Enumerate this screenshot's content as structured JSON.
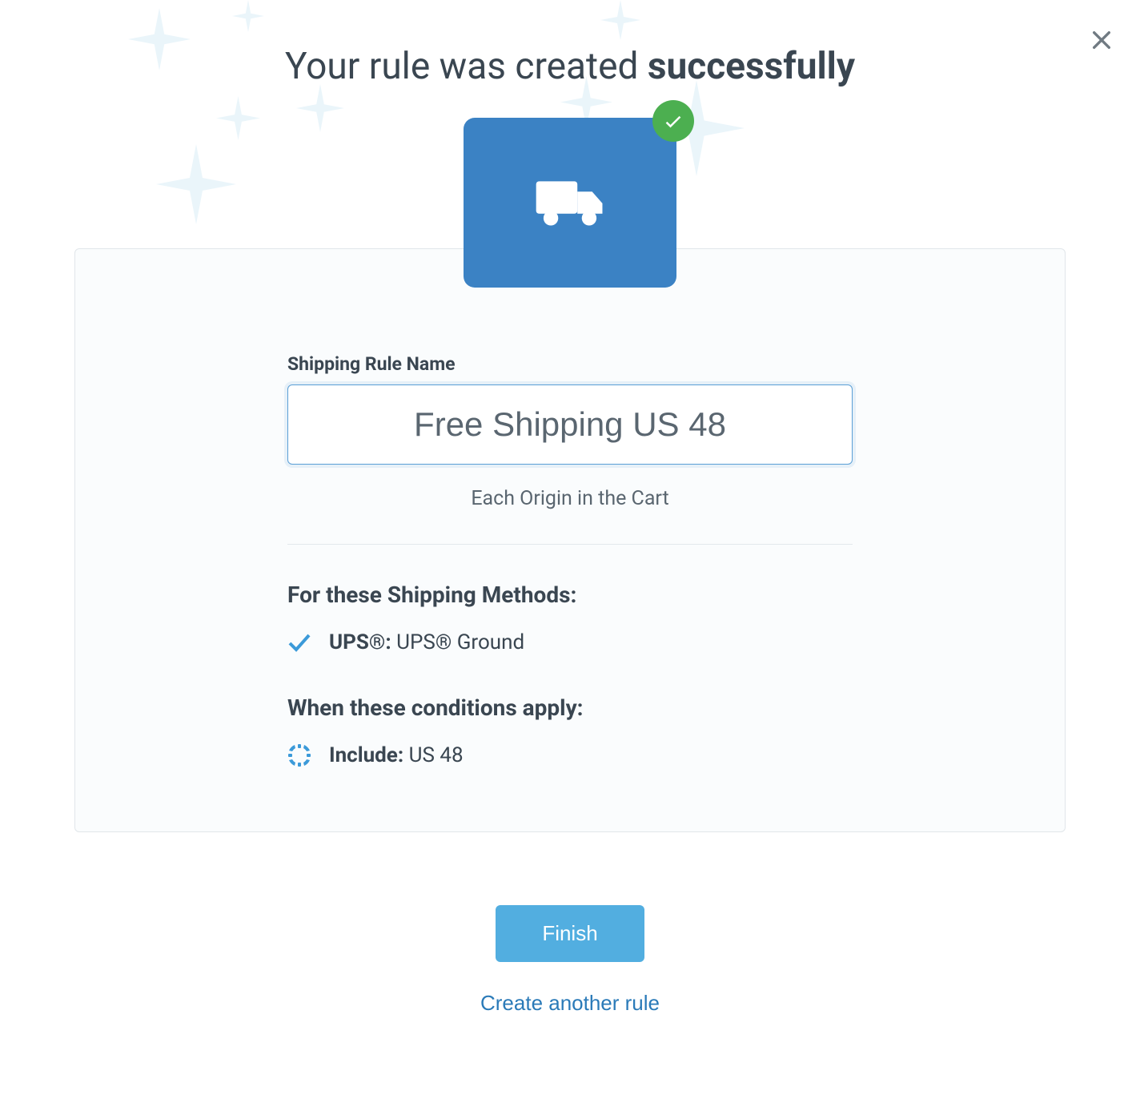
{
  "heading": {
    "prefix": "Your rule was created ",
    "bold": "successfully"
  },
  "card": {
    "rule_name_label": "Shipping Rule Name",
    "rule_name_value": "Free Shipping US 48",
    "origin_subtext": "Each Origin in the Cart",
    "methods_title": "For these Shipping Methods:",
    "methods": [
      {
        "carrier": "UPS®:",
        "service": "UPS® Ground"
      }
    ],
    "conditions_title": "When these conditions apply:",
    "conditions": [
      {
        "label": "Include:",
        "value": "US 48"
      }
    ]
  },
  "actions": {
    "finish_label": "Finish",
    "another_label": "Create another rule"
  }
}
